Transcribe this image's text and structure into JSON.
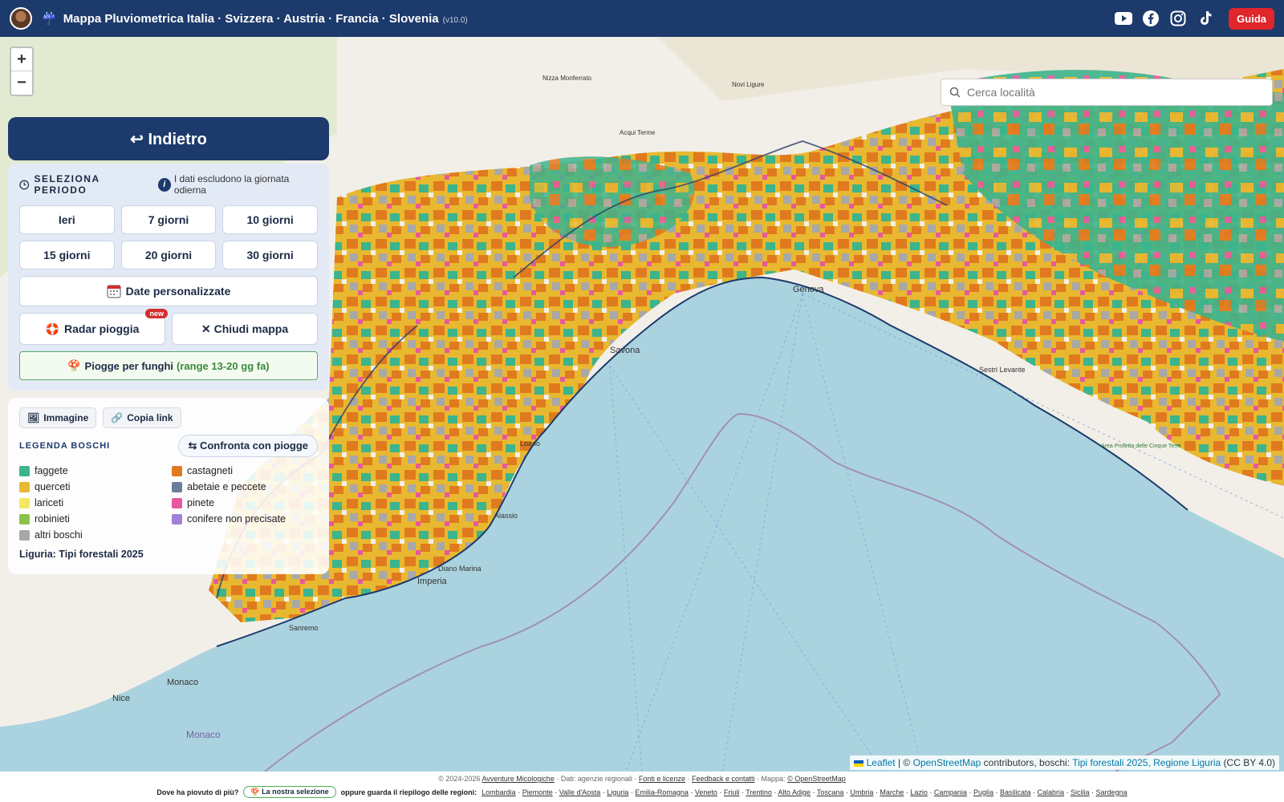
{
  "header": {
    "title": "Mappa Pluviometrica Italia · Svizzera · Austria · Francia · Slovenia",
    "version": "(v10.0)",
    "guide_label": "Guida"
  },
  "search": {
    "placeholder": "Cerca località"
  },
  "map_labels": {
    "genova": "Genova",
    "savona": "Savona",
    "sestri": "Sestri Levante",
    "monaco": "Monaco",
    "monaco2": "Monaco",
    "nice": "Nice",
    "imperia": "Imperia",
    "diano": "Diano Marina",
    "alassio": "Alassio",
    "loano": "Loano",
    "sanremo": "Sanremo",
    "cinque_terre": "Area Protetta delle Cinque Terre",
    "acqui": "Acqui Terme",
    "novi": "Novi Ligure",
    "nizza": "Nizza Monferrato"
  },
  "back_label": "↩ Indietro",
  "period": {
    "heading": "SELEZIONA PERIODO",
    "note": "I dati escludono la giornata odierna",
    "buttons": [
      "Ieri",
      "7 giorni",
      "10 giorni",
      "15 giorni",
      "20 giorni",
      "30 giorni"
    ],
    "custom_dates": "Date personalizzate",
    "radar": "Radar pioggia",
    "new_badge": "new",
    "close_map": "Chiudi mappa",
    "mushroom_label": "Piogge per funghi",
    "mushroom_range": "(range 13-20 gg fa)"
  },
  "legend": {
    "image_btn": "Immagine",
    "copy_btn": "Copia link",
    "title": "LEGENDA BOSCHI",
    "compare_btn": "Confronta con piogge",
    "items": [
      {
        "label": "faggete",
        "color": "#3cb48c"
      },
      {
        "label": "castagneti",
        "color": "#e07a1f"
      },
      {
        "label": "querceti",
        "color": "#e8b830"
      },
      {
        "label": "abetaie e peccete",
        "color": "#6a7d9a"
      },
      {
        "label": "lariceti",
        "color": "#f5e860"
      },
      {
        "label": "pinete",
        "color": "#e8589e"
      },
      {
        "label": "robinieti",
        "color": "#8bc34a"
      },
      {
        "label": "conifere non precisate",
        "color": "#a080d8"
      },
      {
        "label": "altri boschi",
        "color": "#a8a8a8"
      }
    ],
    "footer": "Liguria: Tipi forestali 2025"
  },
  "attribution": {
    "leaflet": "Leaflet",
    "text1": "| ©",
    "osm": "OpenStreetMap",
    "text2": "contributors, boschi:",
    "source": "Tipi forestali 2025, Regione Liguria",
    "license": "(CC BY 4.0)"
  },
  "footer": {
    "copyright": "© 2024-2026",
    "site": "Avventure Micologiche",
    "data": "· Dati: agenzie regionali ·",
    "sources": "Fonti e licenze",
    "feedback": "Feedback e contatti",
    "map": "· Mappa:",
    "osm": "© OpenStreetMap",
    "question": "Dove ha piovuto di più?",
    "selection": "🍄 La nostra selezione",
    "summary": "oppure guarda il riepilogo delle regioni:",
    "regions": [
      "Lombardia",
      "Piemonte",
      "Valle d'Aosta",
      "Liguria",
      "Emilia-Romagna",
      "Veneto",
      "Friuli",
      "Trentino",
      "Alto Adige",
      "Toscana",
      "Umbria",
      "Marche",
      "Lazio",
      "Campania",
      "Puglia",
      "Basilicata",
      "Calabria",
      "Sicilia",
      "Sardegna"
    ]
  },
  "colors": {
    "header_bg": "#1c3a6b",
    "sea": "#aad3df",
    "accent_red": "#e0252b",
    "land": "#f2efe9"
  }
}
